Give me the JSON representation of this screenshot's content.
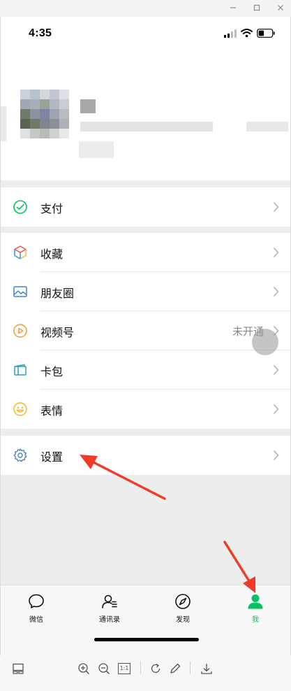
{
  "window": {
    "controls": [
      "minimize-icon",
      "maximize-icon",
      "close-icon"
    ]
  },
  "status_bar": {
    "time": "4:35",
    "icons": [
      "signal-icon",
      "wifi-icon",
      "battery-icon"
    ]
  },
  "menu": {
    "pay": {
      "label": "支付",
      "icon": "wechat-pay-icon"
    },
    "favorites": {
      "label": "收藏",
      "icon": "cube-icon"
    },
    "moments": {
      "label": "朋友圈",
      "icon": "image-icon"
    },
    "channels": {
      "label": "视频号",
      "icon": "play-circle-icon",
      "status": "未开通"
    },
    "card": {
      "label": "卡包",
      "icon": "card-wallet-icon"
    },
    "stickers": {
      "label": "表情",
      "icon": "smiley-icon"
    },
    "settings": {
      "label": "设置",
      "icon": "gear-icon"
    }
  },
  "tabs": [
    {
      "label": "微信",
      "icon": "chat-bubble-icon",
      "active": false
    },
    {
      "label": "通讯录",
      "icon": "contacts-icon",
      "active": false
    },
    {
      "label": "发现",
      "icon": "compass-icon",
      "active": false
    },
    {
      "label": "我",
      "icon": "person-icon",
      "active": true
    }
  ],
  "toolbar": {
    "icons": [
      "layout-icon",
      "zoom-in-icon",
      "zoom-out-icon",
      "actual-size-icon",
      "rotate-icon",
      "edit-pencil-icon",
      "download-icon"
    ],
    "actual_size_label": "1:1"
  },
  "colors": {
    "accent": "#07c160",
    "annotation_arrow": "#f03a2a"
  }
}
